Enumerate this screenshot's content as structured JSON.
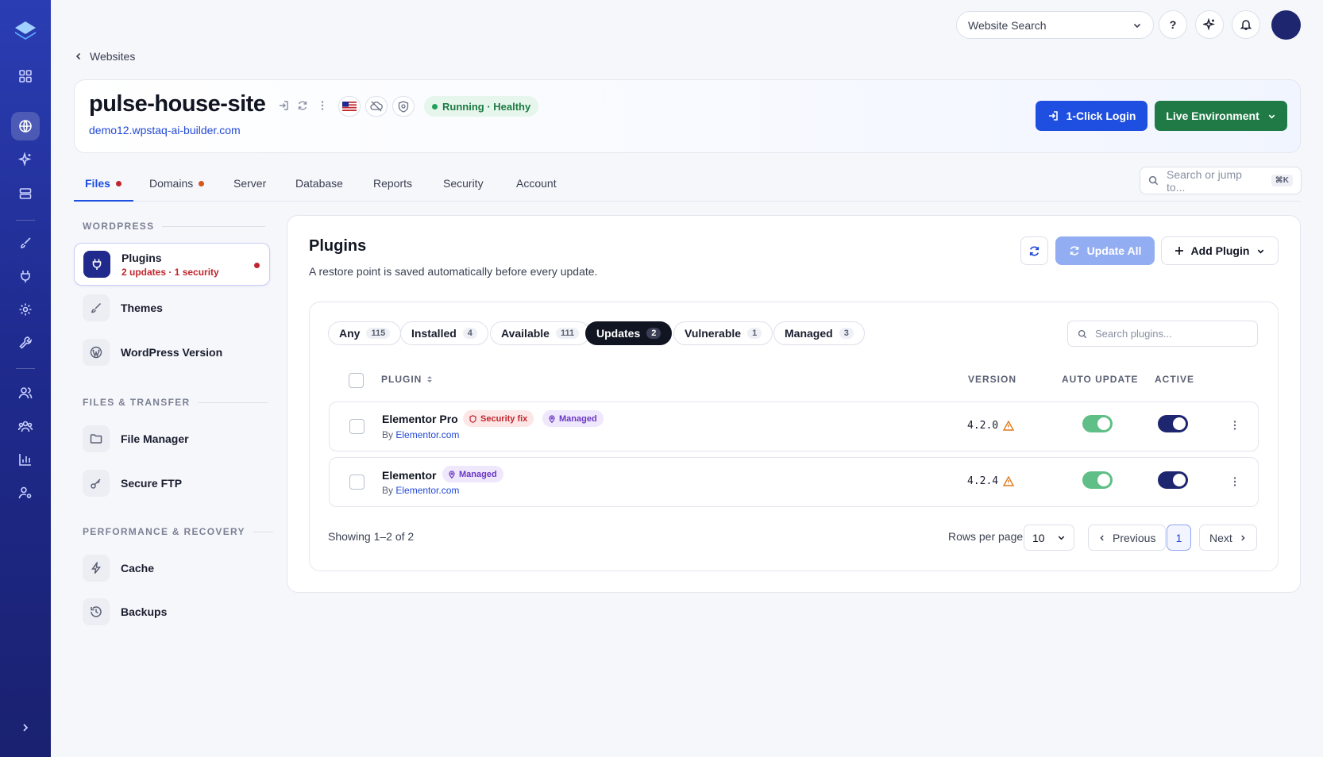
{
  "topbar": {
    "website_search": "Website Search",
    "help": "?"
  },
  "breadcrumb": {
    "back_label": "Websites"
  },
  "site": {
    "name": "pulse-house-site",
    "url": "demo12.wpstaq-ai-builder.com",
    "status": "Running · Healthy",
    "login_label": "1-Click Login",
    "environment_label": "Live Environment"
  },
  "tabs": [
    {
      "label": "Files",
      "dot_color": "#c0262d"
    },
    {
      "label": "Domains",
      "dot_color": "#d4571c"
    },
    {
      "label": "Server"
    },
    {
      "label": "Database"
    },
    {
      "label": "Reports"
    },
    {
      "label": "Security"
    },
    {
      "label": "Account"
    }
  ],
  "jump": {
    "placeholder": "Search or jump to...",
    "shortcut": "⌘K"
  },
  "sidebar": {
    "sections": [
      {
        "title": "WORDPRESS"
      },
      {
        "title": "FILES & TRANSFER"
      },
      {
        "title": "PERFORMANCE & RECOVERY"
      }
    ],
    "items": [
      {
        "label": "Plugins",
        "sub": "2 updates · 1 security",
        "icon": "plug-icon"
      },
      {
        "label": "Themes",
        "icon": "brush-icon"
      },
      {
        "label": "WordPress Version",
        "icon": "wordpress-icon"
      },
      {
        "label": "File Manager",
        "icon": "folder-icon"
      },
      {
        "label": "Secure FTP",
        "icon": "key-icon"
      },
      {
        "label": "Cache",
        "icon": "bolt-icon"
      },
      {
        "label": "Backups",
        "icon": "history-icon"
      }
    ]
  },
  "plugins": {
    "title": "Plugins",
    "subtitle": "A restore point is saved automatically before every update.",
    "update_all": "Update All",
    "add_plugin": "Add Plugin",
    "filters": [
      {
        "label": "Any",
        "count": "115"
      },
      {
        "label": "Installed",
        "count": "4"
      },
      {
        "label": "Available",
        "count": "111"
      },
      {
        "label": "Updates",
        "count": "2"
      },
      {
        "label": "Vulnerable",
        "count": "1"
      },
      {
        "label": "Managed",
        "count": "3"
      }
    ],
    "search_placeholder": "Search plugins...",
    "columns": {
      "plugin": "PLUGIN",
      "version": "VERSION",
      "auto_update": "AUTO UPDATE",
      "active": "ACTIVE"
    },
    "rows": [
      {
        "name": "Elementor Pro",
        "badges": [
          "Security fix",
          "Managed"
        ],
        "by": "By",
        "author": "Elementor.com",
        "version": "4.2.0",
        "auto_update": true,
        "active": true
      },
      {
        "name": "Elementor",
        "badges": [
          "Managed"
        ],
        "by": "By",
        "author": "Elementor.com",
        "version": "4.2.4",
        "auto_update": true,
        "active": true
      }
    ],
    "footer": {
      "showing": "Showing 1–2 of 2",
      "rows_per_page_label": "Rows per page",
      "rows_per_page": "10",
      "previous": "Previous",
      "page": "1",
      "next": "Next"
    }
  }
}
